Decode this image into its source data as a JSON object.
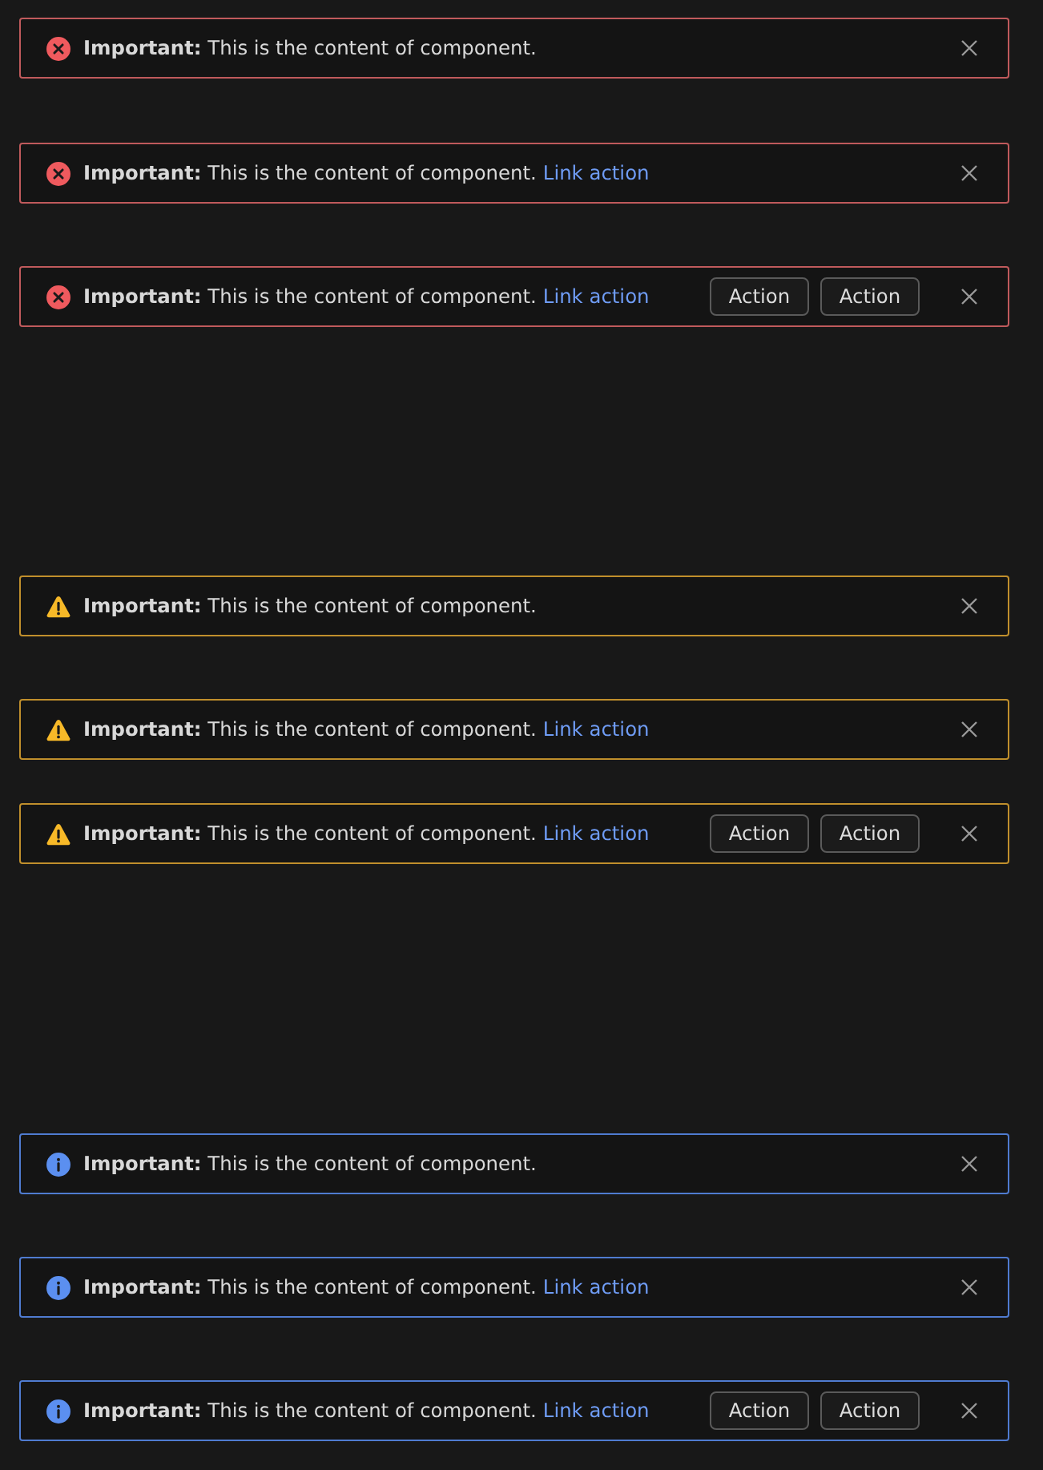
{
  "banners": [
    {
      "kind": "error",
      "message": "**Important:** This is the content of component."
    },
    {
      "kind": "error",
      "message": "**Important:** This is the content of component.",
      "link": "Link action"
    },
    {
      "kind": "error",
      "message": "**Important:** This is the content of component.",
      "link": "Link action",
      "actions": [
        "Action",
        "Action"
      ]
    },
    {
      "kind": "warning",
      "message": "**Important:** This is the content of component."
    },
    {
      "kind": "warning",
      "message": "**Important:** This is the content of component.",
      "link": "Link action"
    },
    {
      "kind": "warning",
      "message": "**Important:** This is the content of component.",
      "link": "Link action",
      "actions": [
        "Action",
        "Action"
      ]
    },
    {
      "kind": "info",
      "message": "**Important:** This is the content of component."
    },
    {
      "kind": "info",
      "message": "**Important:** This is the content of component.",
      "link": "Link action"
    },
    {
      "kind": "info",
      "message": "**Important:** This is the content of component.",
      "link": "Link action",
      "actions": [
        "Action",
        "Action"
      ]
    }
  ]
}
